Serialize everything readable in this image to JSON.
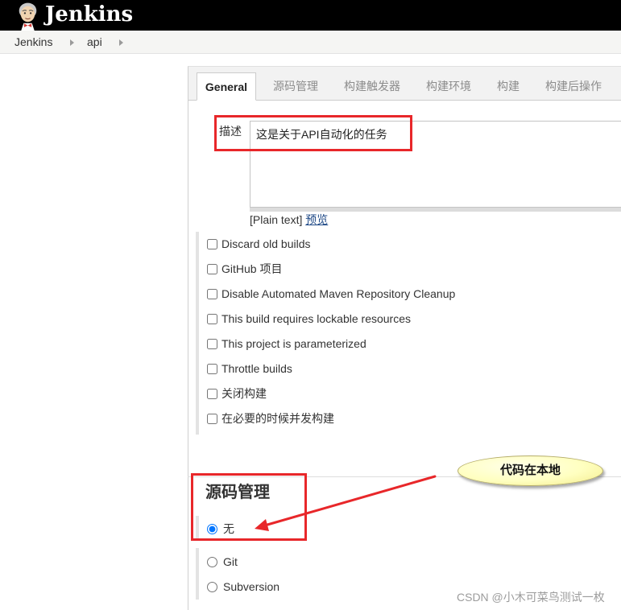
{
  "header": {
    "brand": "Jenkins",
    "logo_icon": "jenkins-logo-icon"
  },
  "breadcrumb": {
    "separator_icon": "breadcrumb-arrow-icon",
    "items": [
      {
        "label": "Jenkins"
      },
      {
        "label": "api"
      }
    ]
  },
  "tabs": [
    {
      "label": "General",
      "active": true
    },
    {
      "label": "源码管理",
      "active": false
    },
    {
      "label": "构建触发器",
      "active": false
    },
    {
      "label": "构建环境",
      "active": false
    },
    {
      "label": "构建",
      "active": false
    },
    {
      "label": "构建后操作",
      "active": false
    }
  ],
  "general": {
    "description": {
      "label": "描述",
      "value": "这是关于API自动化的任务",
      "format": "[Plain text]",
      "preview_link": "预览"
    },
    "options": [
      {
        "label": "Discard old builds",
        "checked": false
      },
      {
        "label": "GitHub 项目",
        "checked": false
      },
      {
        "label": "Disable Automated Maven Repository Cleanup",
        "checked": false
      },
      {
        "label": "This build requires lockable resources",
        "checked": false
      },
      {
        "label": "This project is parameterized",
        "checked": false
      },
      {
        "label": "Throttle builds",
        "checked": false
      },
      {
        "label": "关闭构建",
        "checked": false
      },
      {
        "label": "在必要的时候并发构建",
        "checked": false
      }
    ]
  },
  "scm": {
    "title": "源码管理",
    "options": [
      {
        "label": "无",
        "selected": true
      },
      {
        "label": "Git",
        "selected": false
      },
      {
        "label": "Subversion",
        "selected": false
      }
    ]
  },
  "annotation": {
    "callout": "代码在本地"
  },
  "watermark": "CSDN @小木可菜鸟测试一枚",
  "colors": {
    "header_bg": "#000000",
    "annotation_red": "#e8272a",
    "link": "#204a87",
    "callout_yellow": "#ffffc0"
  }
}
